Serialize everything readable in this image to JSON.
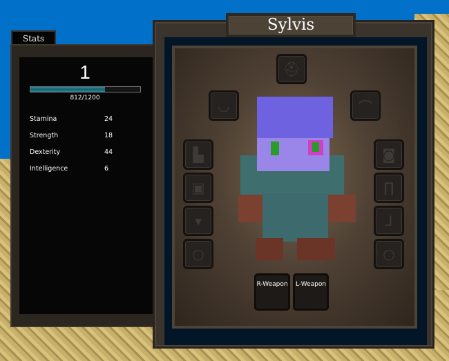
{
  "stats_panel": {
    "tab_label": "Stats",
    "level": "1",
    "xp_text": "812/1200",
    "xp_fraction": 0.677,
    "stats": [
      {
        "label": "Stamina",
        "value": "24"
      },
      {
        "label": "Strength",
        "value": "18"
      },
      {
        "label": "Dexterity",
        "value": "44"
      },
      {
        "label": "Intelligence",
        "value": "6"
      }
    ]
  },
  "character_panel": {
    "name": "Sylvis",
    "weapons": {
      "right": "R-Weapon",
      "left": "L-Weapon"
    },
    "slots": [
      "helmet-icon",
      "amulet-icon",
      "shoulders-icon",
      "chest-icon",
      "armor-icon",
      "belt-icon",
      "ring-icon",
      "gloves-icon",
      "pants-icon",
      "boots-icon",
      "ring-icon"
    ]
  }
}
